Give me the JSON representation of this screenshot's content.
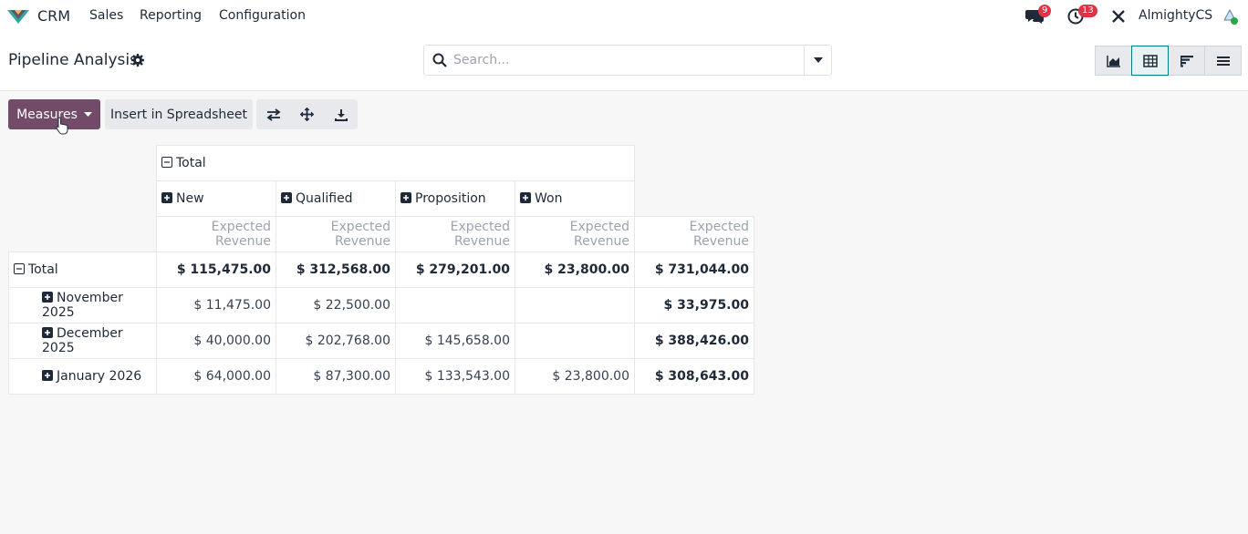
{
  "nav": {
    "app_name": "CRM",
    "menus": [
      "Sales",
      "Reporting",
      "Configuration"
    ],
    "messages_count": "9",
    "activities_count": "13",
    "company": "AlmightyCS"
  },
  "control_panel": {
    "title": "Pipeline Analysis",
    "search_placeholder": "Search..."
  },
  "toolbar": {
    "measures_label": "Measures",
    "insert_label": "Insert in Spreadsheet"
  },
  "pivot": {
    "col_total_label": "Total",
    "col_groups": [
      "New",
      "Qualified",
      "Proposition",
      "Won"
    ],
    "measure_label": "Expected Revenue",
    "row_total_label": "Total",
    "total_row": [
      "$ 115,475.00",
      "$ 312,568.00",
      "$ 279,201.00",
      "$ 23,800.00",
      "$ 731,044.00"
    ],
    "rows": [
      {
        "label": "November 2025",
        "values": [
          "$ 11,475.00",
          "$ 22,500.00",
          "",
          "",
          "$ 33,975.00"
        ]
      },
      {
        "label": "December 2025",
        "values": [
          "$ 40,000.00",
          "$ 202,768.00",
          "$ 145,658.00",
          "",
          "$ 388,426.00"
        ]
      },
      {
        "label": "January 2026",
        "values": [
          "$ 64,000.00",
          "$ 87,300.00",
          "$ 133,543.00",
          "$ 23,800.00",
          "$ 308,643.00"
        ]
      }
    ]
  },
  "colors": {
    "primary": "#714b67",
    "accent": "#017e84",
    "badge": "#dc3545"
  }
}
